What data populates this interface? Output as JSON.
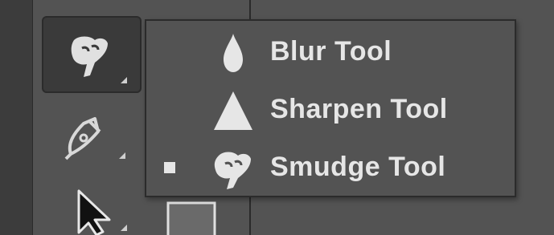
{
  "toolbar": {
    "active_tool_icon": "smudge-icon",
    "tools": [
      {
        "icon": "smudge-icon"
      },
      {
        "icon": "pen-icon"
      },
      {
        "icon": "move-arrow-icon"
      },
      {
        "icon": "rectangle-icon"
      }
    ]
  },
  "flyout": {
    "items": [
      {
        "label": "Blur Tool",
        "icon": "blur-drop-icon",
        "selected": false
      },
      {
        "label": "Sharpen Tool",
        "icon": "sharpen-triangle-icon",
        "selected": false
      },
      {
        "label": "Smudge Tool",
        "icon": "smudge-finger-icon",
        "selected": true
      }
    ]
  },
  "colors": {
    "panel_bg": "#535353",
    "menu_text": "#e6e6e6",
    "active_button_bg": "#3a3a3a"
  }
}
